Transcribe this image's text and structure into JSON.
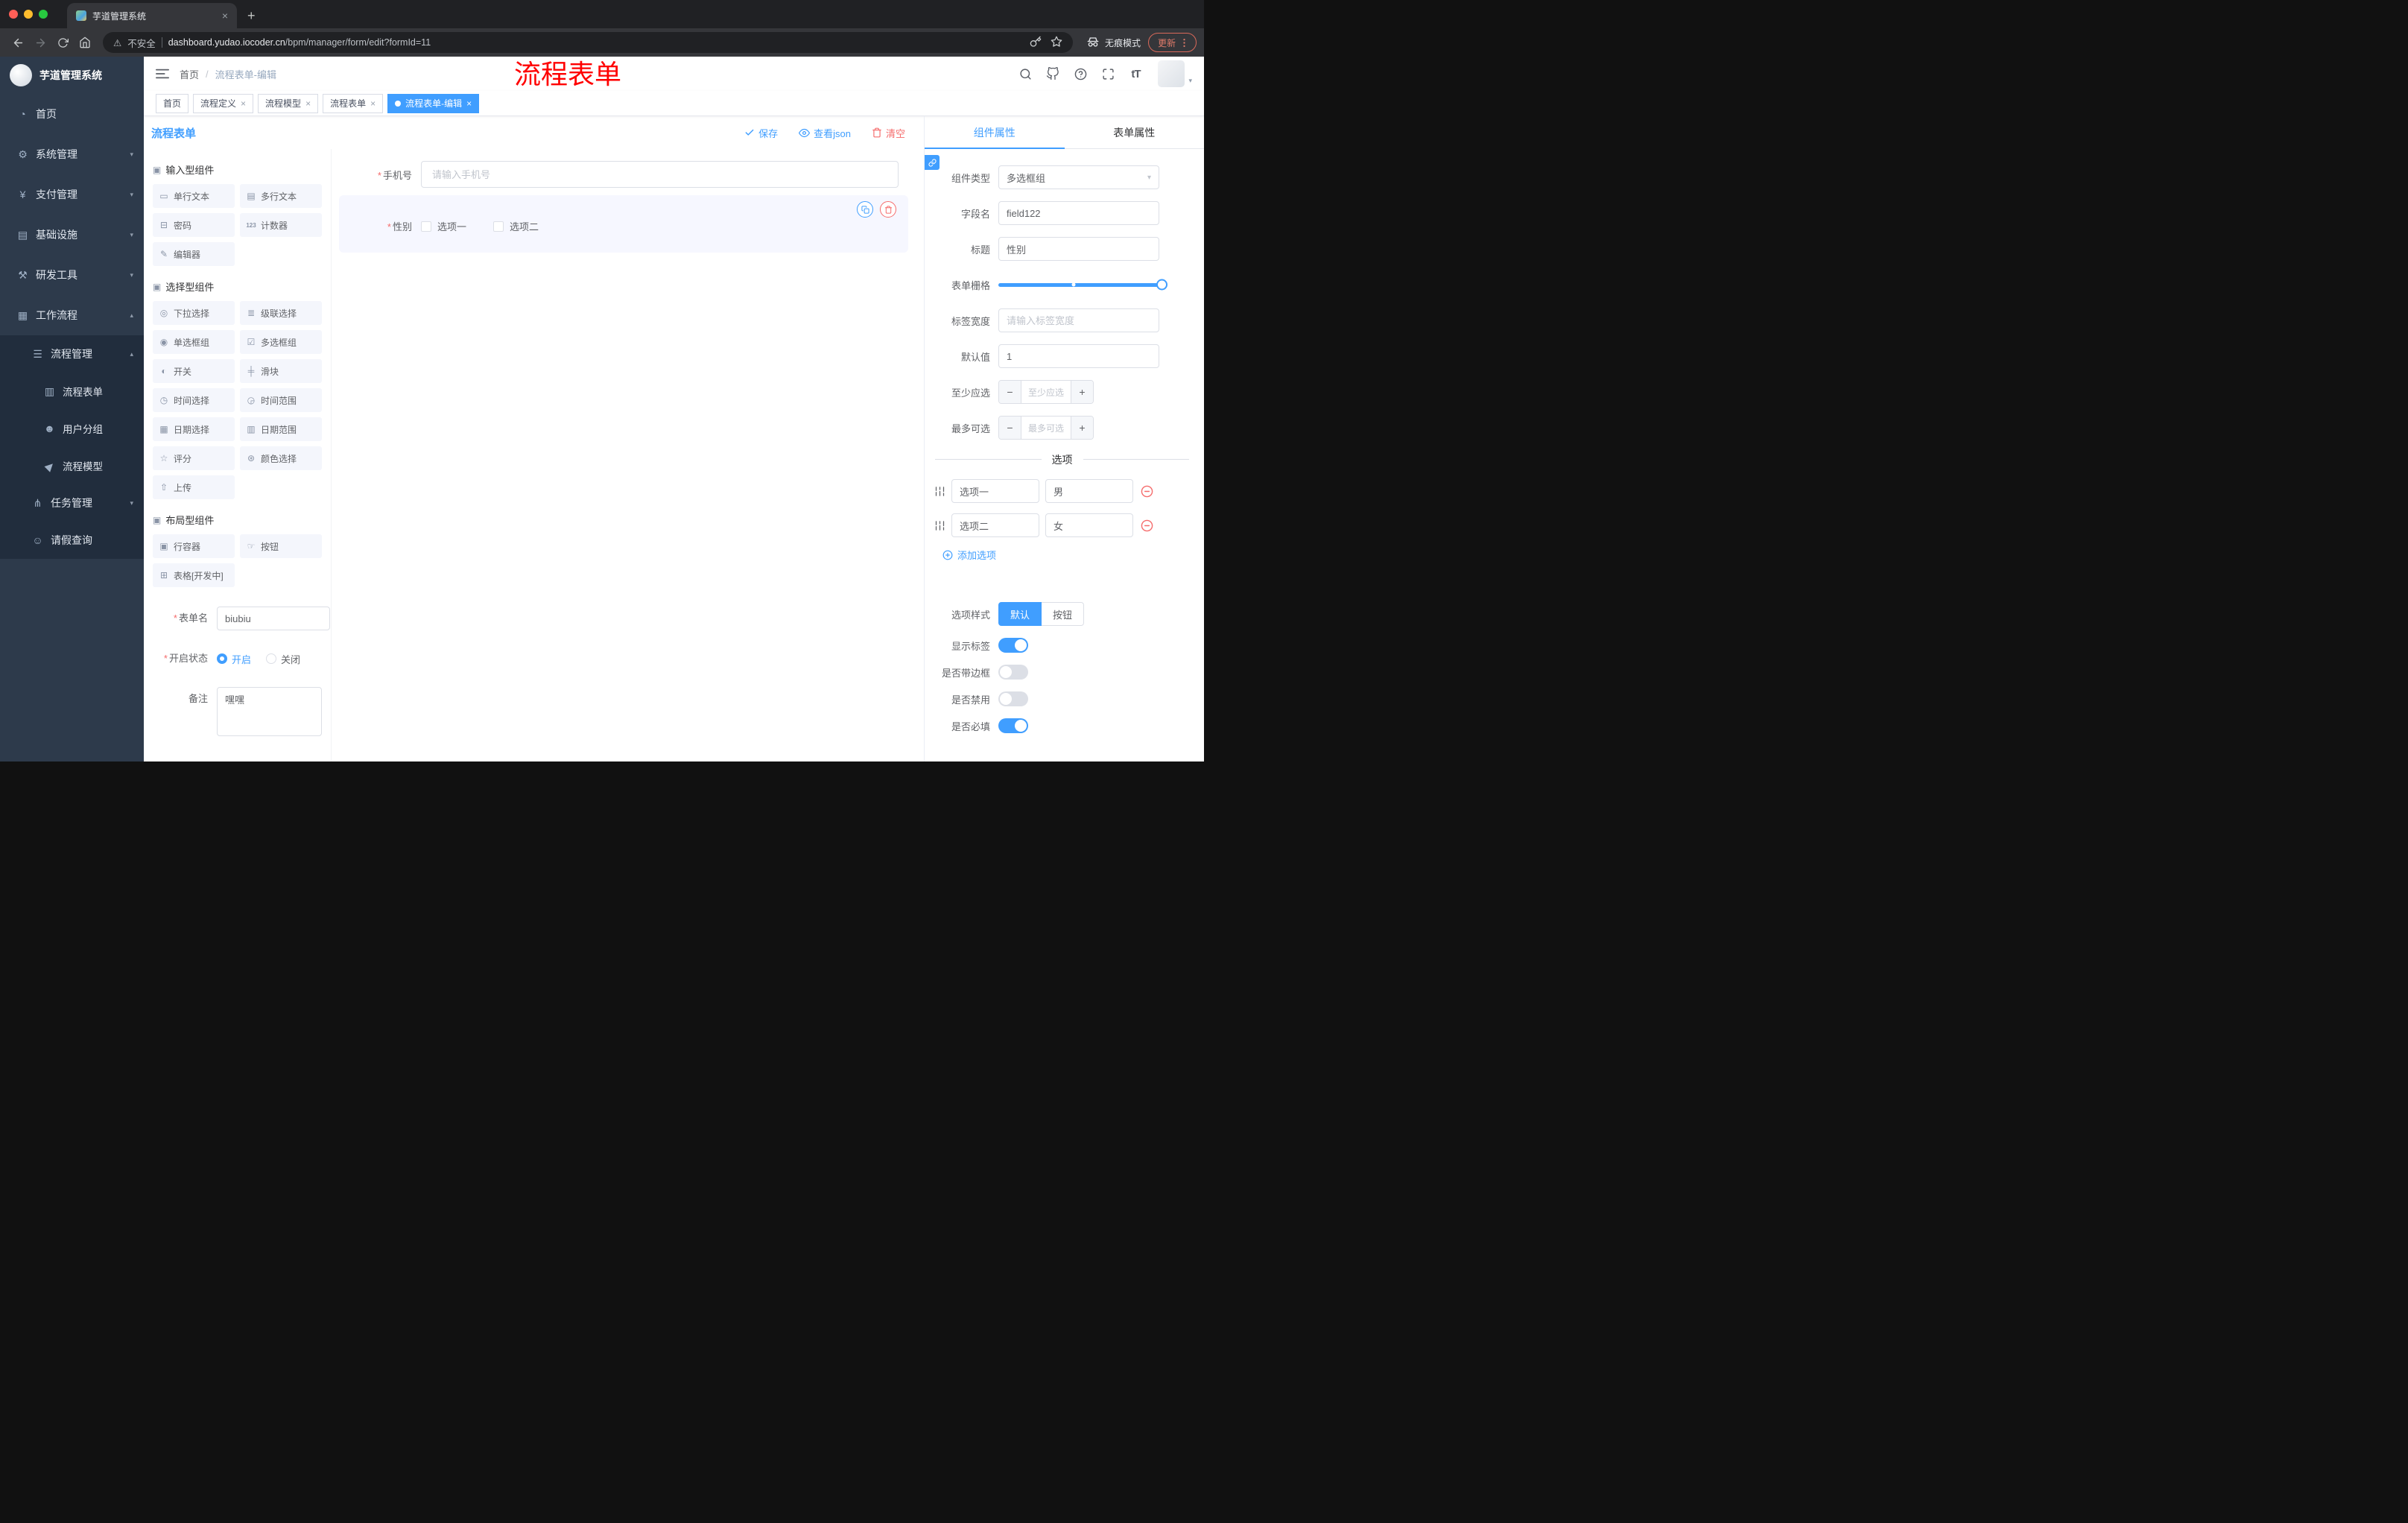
{
  "glyphs": {
    "close": "×",
    "plus": "+",
    "minus": "−",
    "caret_down": "▾",
    "warning": "⚠"
  },
  "browser": {
    "tab_title": "芋道管理系统",
    "security_label": "不安全",
    "url_domain": "dashboard.yudao.iocoder.cn",
    "url_path": "/bpm/manager/form/edit?formId=11",
    "incognito_label": "无痕模式",
    "update_label": "更新"
  },
  "sidebar": {
    "app_title": "芋道管理系统",
    "menu": [
      {
        "icon": "◔",
        "label": "首页",
        "chevron": ""
      },
      {
        "icon": "⚙",
        "label": "系统管理",
        "chevron": "▾"
      },
      {
        "icon": "¥",
        "label": "支付管理",
        "chevron": "▾"
      },
      {
        "icon": "▤",
        "label": "基础设施",
        "chevron": "▾"
      },
      {
        "icon": "⚒",
        "label": "研发工具",
        "chevron": "▾"
      },
      {
        "icon": "▦",
        "label": "工作流程",
        "chevron": "▴"
      },
      {
        "icon": "☰",
        "label": "流程管理",
        "chevron": "▴"
      },
      {
        "icon": "▥",
        "label": "流程表单",
        "chevron": ""
      },
      {
        "icon": "☻",
        "label": "用户分组",
        "chevron": ""
      },
      {
        "icon": "▶",
        "label": "流程模型",
        "chevron": ""
      },
      {
        "icon": "⋔",
        "label": "任务管理",
        "chevron": "▾"
      },
      {
        "icon": "☺",
        "label": "请假查询",
        "chevron": ""
      }
    ]
  },
  "navbar": {
    "breadcrumb_home": "首页",
    "breadcrumb_sep": "/",
    "breadcrumb_current": "流程表单-编辑",
    "annotation": "流程表单",
    "text_size_tool": "tT"
  },
  "tags": [
    {
      "label": "首页",
      "close": ""
    },
    {
      "label": "流程定义",
      "close": "×"
    },
    {
      "label": "流程模型",
      "close": "×"
    },
    {
      "label": "流程表单",
      "close": "×"
    },
    {
      "label": "流程表单-编辑",
      "close": "×"
    }
  ],
  "designer": {
    "title": "流程表单",
    "save_label": "保存",
    "view_json_label": "查看json",
    "clear_label": "清空",
    "required_marker": "*",
    "sections": [
      {
        "icon": "▣",
        "title": "输入型组件"
      },
      {
        "icon": "▣",
        "title": "选择型组件"
      },
      {
        "icon": "▣",
        "title": "布局型组件"
      }
    ],
    "components_input": [
      {
        "icon": "▭",
        "label": "单行文本"
      },
      {
        "icon": "▤",
        "label": "多行文本"
      },
      {
        "icon": "⊟",
        "label": "密码"
      },
      {
        "icon": "123",
        "label": "计数器"
      },
      {
        "icon": "✎",
        "label": "编辑器"
      }
    ],
    "components_select": [
      {
        "icon": "◎",
        "label": "下拉选择"
      },
      {
        "icon": "≣",
        "label": "级联选择"
      },
      {
        "icon": "◉",
        "label": "单选框组"
      },
      {
        "icon": "☑",
        "label": "多选框组"
      },
      {
        "icon": "◐",
        "label": "开关"
      },
      {
        "icon": "╪",
        "label": "滑块"
      },
      {
        "icon": "◷",
        "label": "时间选择"
      },
      {
        "icon": "◶",
        "label": "时间范围"
      },
      {
        "icon": "▦",
        "label": "日期选择"
      },
      {
        "icon": "▥",
        "label": "日期范围"
      },
      {
        "icon": "☆",
        "label": "评分"
      },
      {
        "icon": "⊛",
        "label": "颜色选择"
      },
      {
        "icon": "⇧",
        "label": "上传"
      }
    ],
    "components_layout": [
      {
        "icon": "▣",
        "label": "行容器"
      },
      {
        "icon": "☞",
        "label": "按钮"
      },
      {
        "icon": "⊞",
        "label": "表格[开发中]"
      }
    ],
    "meta": {
      "name_label": "表单名",
      "name_value": "biubiu",
      "status_label": "开启状态",
      "status_on": "开启",
      "status_off": "关闭",
      "remark_label": "备注",
      "remark_value": "嘿嘿"
    },
    "canvas": {
      "phone_label": "手机号",
      "phone_placeholder": "请输入手机号",
      "gender_label": "性别",
      "gender_opt1": "选项一",
      "gender_opt2": "选项二"
    }
  },
  "props": {
    "tab_component": "组件属性",
    "tab_form": "表单属性",
    "type_label": "组件类型",
    "type_value": "多选框组",
    "field_label": "字段名",
    "field_value": "field122",
    "title_label": "标题",
    "title_value": "性别",
    "grid_label": "表单栅格",
    "label_width_label": "标签宽度",
    "label_width_placeholder": "请输入标签宽度",
    "default_label": "默认值",
    "default_value": "1",
    "min_label": "至少应选",
    "min_placeholder": "至少应选",
    "max_label": "最多可选",
    "max_placeholder": "最多可选",
    "divider": "选项",
    "options": [
      {
        "name": "选项一",
        "value": "男"
      },
      {
        "name": "选项二",
        "value": "女"
      }
    ],
    "add_option": "添加选项",
    "style_label": "选项样式",
    "style_default": "默认",
    "style_button": "按钮",
    "show_label": "显示标签",
    "border_label": "是否带边框",
    "disabled_label": "是否禁用",
    "required_label": "是否必填"
  },
  "colors": {
    "primary": "#409EFF",
    "danger": "#F56C6C",
    "annotation_red": "#FF0000",
    "sidebar_bg": "#2d3a4b",
    "sidebar_sub_bg": "#212d3d"
  }
}
